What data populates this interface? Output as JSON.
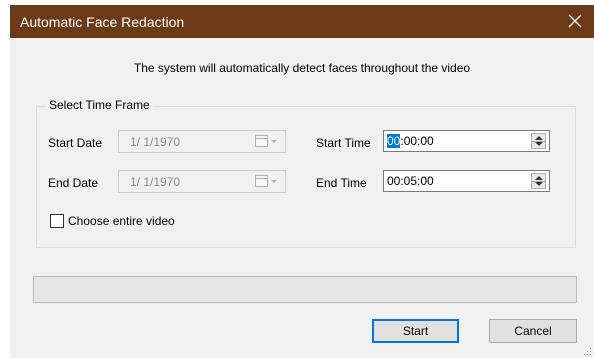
{
  "window": {
    "title": "Automatic Face Redaction",
    "accent": "#6b3a17"
  },
  "subtitle": "The system will automatically detect faces throughout the video",
  "time_frame": {
    "group_label": "Select Time Frame",
    "start_date_label": "Start Date",
    "start_date_value": "1/  1/1970",
    "end_date_label": "End Date",
    "end_date_value": "1/  1/1970",
    "start_time_label": "Start Time",
    "start_time_selected": "00",
    "start_time_rest": ":00:00",
    "end_time_label": "End Time",
    "end_time_value": "00:05:00"
  },
  "entire_video": {
    "label": "Choose entire video",
    "checked": false
  },
  "progress": {
    "value": 0
  },
  "buttons": {
    "start": "Start",
    "cancel": "Cancel"
  }
}
